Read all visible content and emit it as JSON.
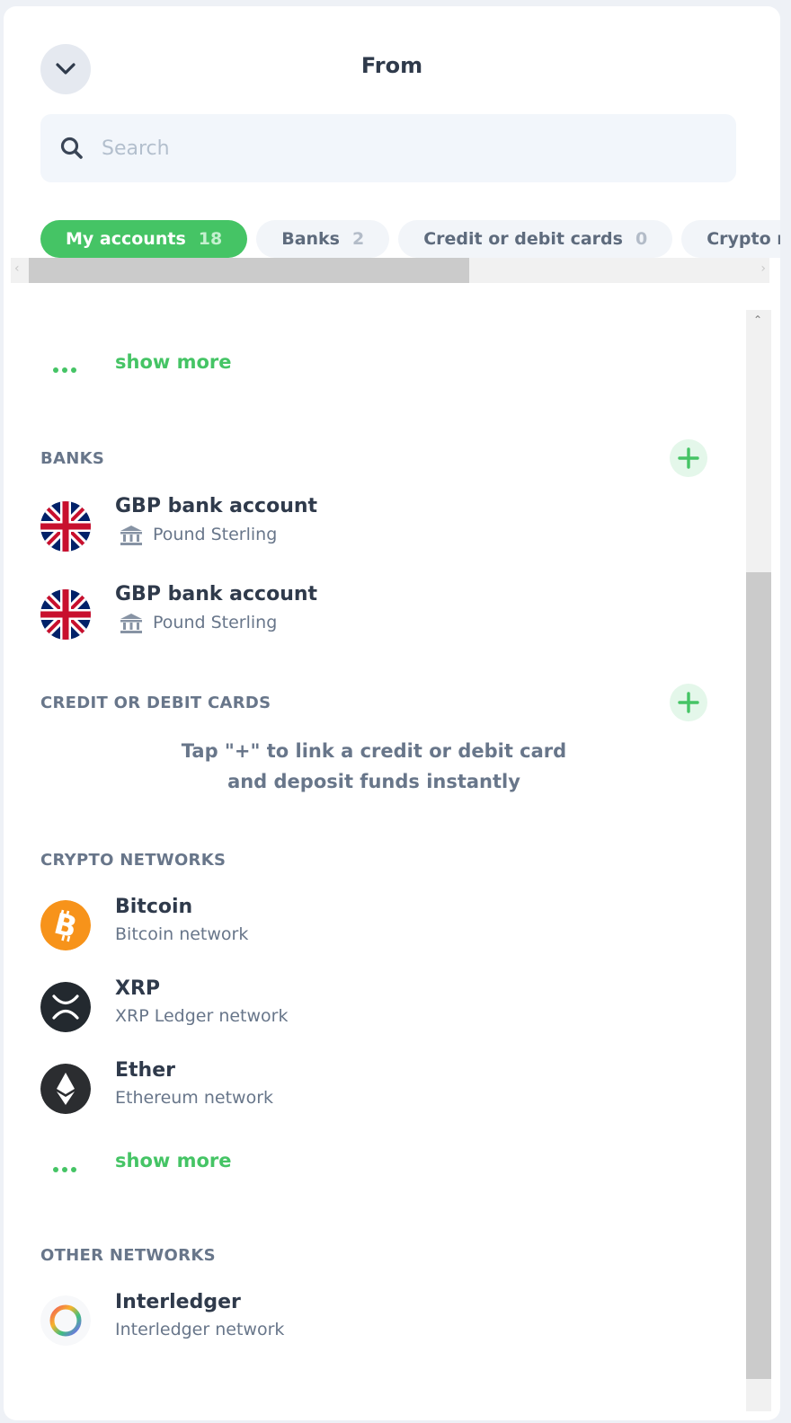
{
  "header": {
    "title": "From",
    "collapse_icon": "chevron-down-icon"
  },
  "search": {
    "placeholder": "Search",
    "value": "",
    "icon": "search-icon"
  },
  "tabs": [
    {
      "label": "My accounts",
      "count": "18",
      "active": true
    },
    {
      "label": "Banks",
      "count": "2",
      "active": false
    },
    {
      "label": "Credit or debit cards",
      "count": "0",
      "active": false
    },
    {
      "label": "Crypto networks",
      "count": "",
      "active": false
    }
  ],
  "show_more_label": "show more",
  "banks": {
    "title": "BANKS",
    "items": [
      {
        "name": "GBP bank account",
        "currency": "Pound Sterling",
        "icon": "uk-flag-icon"
      },
      {
        "name": "GBP bank account",
        "currency": "Pound Sterling",
        "icon": "uk-flag-icon"
      }
    ]
  },
  "cards": {
    "title": "CREDIT OR DEBIT CARDS",
    "empty_line1": "Tap \"+\" to link a credit or debit card",
    "empty_line2": "and deposit funds instantly"
  },
  "crypto": {
    "title": "CRYPTO NETWORKS",
    "items": [
      {
        "name": "Bitcoin",
        "network": "Bitcoin network",
        "icon": "bitcoin-icon"
      },
      {
        "name": "XRP",
        "network": "XRP Ledger network",
        "icon": "xrp-icon"
      },
      {
        "name": "Ether",
        "network": "Ethereum network",
        "icon": "ether-icon"
      }
    ]
  },
  "other": {
    "title": "OTHER NETWORKS",
    "items": [
      {
        "name": "Interledger",
        "network": "Interledger network",
        "icon": "interledger-icon"
      }
    ]
  },
  "colors": {
    "accent_green": "#45c465",
    "text_dark": "#2f3a4b",
    "text_muted": "#68768a",
    "bitcoin_orange": "#f7931a",
    "xrp_dark": "#23292f",
    "uk_blue": "#012169",
    "uk_red": "#c8102e"
  }
}
